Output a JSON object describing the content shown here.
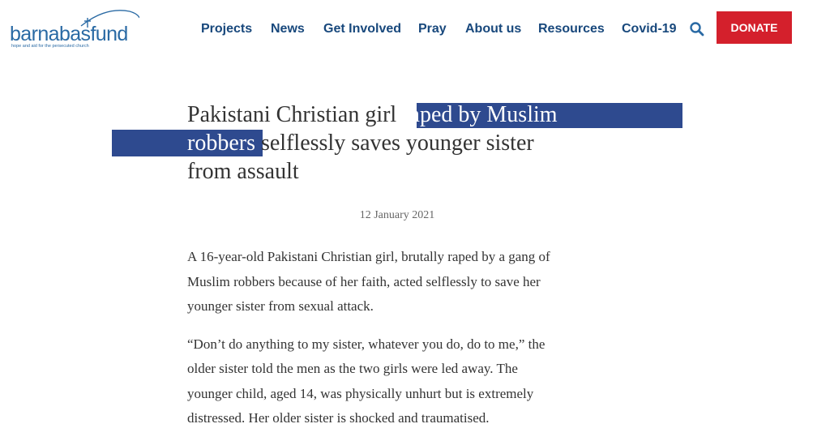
{
  "logo": {
    "wordmark": "barnabasfund",
    "tagline": "hope and aid for the persecuted church"
  },
  "nav": {
    "items": [
      "Projects",
      "News",
      "Get Involved",
      "Pray",
      "About us",
      "Resources",
      "Covid-19"
    ],
    "search_icon": "search-icon",
    "donate_label": "DONATE"
  },
  "article": {
    "title_before": "Pakistani Christian girl ",
    "title_highlight_1": "raped by Muslim",
    "title_highlight_2": "robbers",
    "title_after": " selflessly saves younger sister",
    "title_line3": "from assault",
    "date": "12 January 2021",
    "paragraphs": [
      {
        "lines": [
          "A 16-year-old Pakistani Christian girl, brutally raped by a gang of",
          "Muslim robbers because of her faith, acted selflessly to save her",
          "younger sister from sexual attack."
        ]
      },
      {
        "lines": [
          "“Don’t do anything to my sister, whatever you do, do to me,” the",
          "older sister told the men as the two girls were led away. The",
          "younger child, aged 14, was physically unhurt but is extremely",
          "distressed. Her older sister is shocked and traumatised."
        ]
      }
    ]
  },
  "colors": {
    "brand_blue": "#2a6aa4",
    "nav_blue": "#18487c",
    "donate_red": "#d4202c",
    "highlight": "#2e4a8f",
    "text": "#333333"
  }
}
